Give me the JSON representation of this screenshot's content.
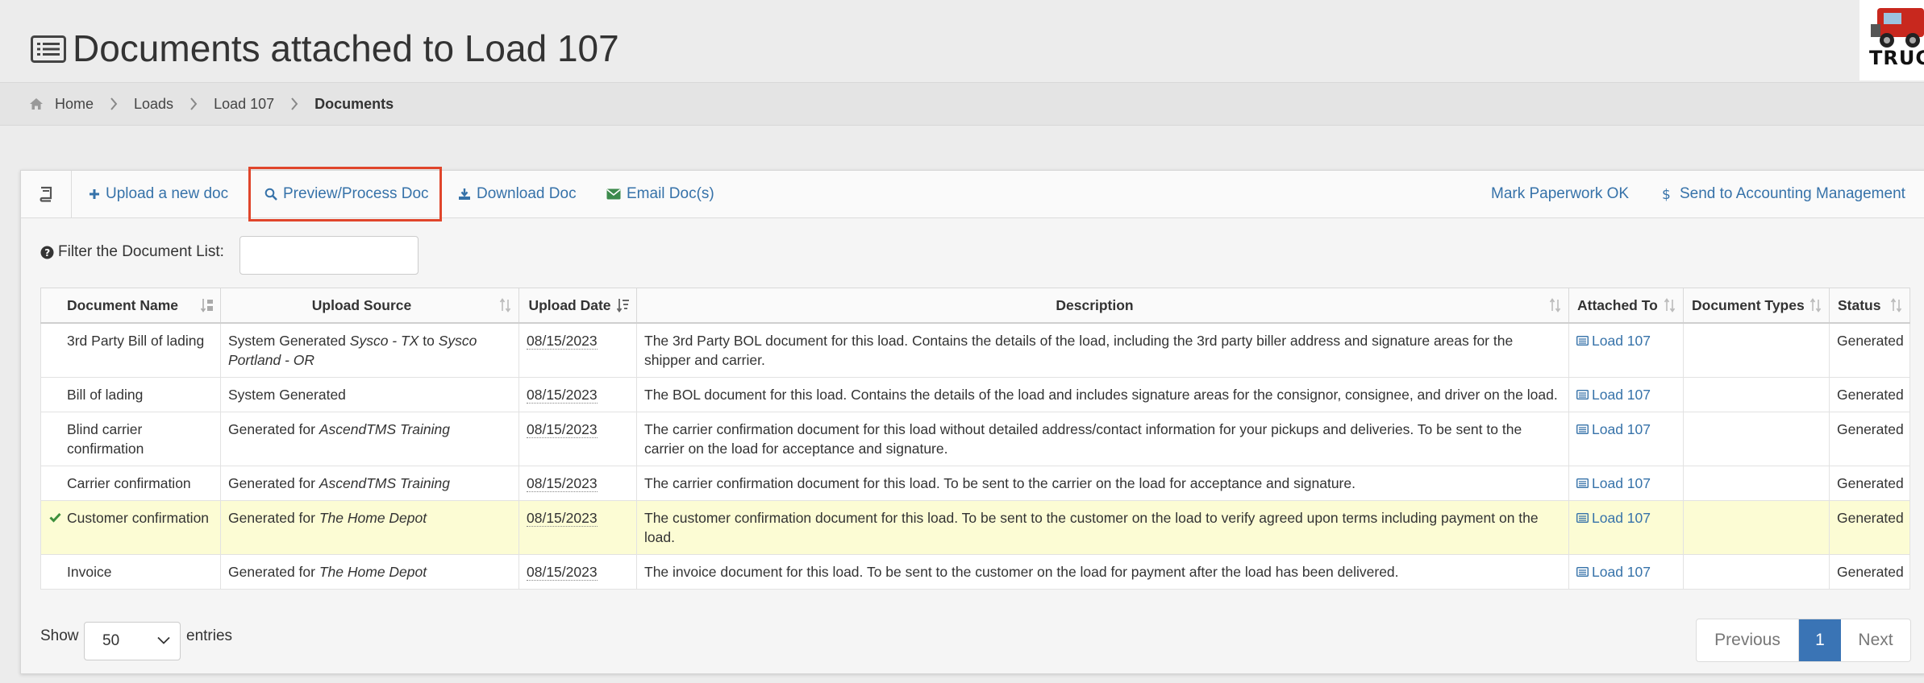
{
  "header": {
    "title": "Documents attached to Load 107",
    "logo_text": "TRUCK"
  },
  "breadcrumb": [
    {
      "label": "Home"
    },
    {
      "label": "Loads"
    },
    {
      "label": "Load 107"
    },
    {
      "label": "Documents"
    }
  ],
  "toolbar": {
    "upload": "Upload a new doc",
    "preview": "Preview/Process Doc",
    "download": "Download Doc",
    "email": "Email Doc(s)",
    "mark_ok": "Mark Paperwork OK",
    "send_accounting": "Send to Accounting Management"
  },
  "filter": {
    "label": "Filter the Document List:",
    "value": ""
  },
  "table": {
    "columns": [
      "Document Name",
      "Upload Source",
      "Upload Date",
      "Description",
      "Attached To",
      "Document Types",
      "Status"
    ],
    "rows": [
      {
        "name": "3rd Party Bill of lading",
        "source_prefix": "System Generated ",
        "source_em": "Sysco - TX",
        "source_mid": " to ",
        "source_em2": "Sysco Portland - OR",
        "date": "08/15/2023",
        "description": "The 3rd Party BOL document for this load. Contains the details of the load, including the 3rd party biller address and signature areas for the shipper and carrier.",
        "attached": "Load 107",
        "types": "",
        "status": "Generated"
      },
      {
        "name": "Bill of lading",
        "source_prefix": "System Generated",
        "source_em": "",
        "source_mid": "",
        "source_em2": "",
        "date": "08/15/2023",
        "description": "The BOL document for this load. Contains the details of the load and includes signature areas for the consignor, consignee, and driver on the load.",
        "attached": "Load 107",
        "types": "",
        "status": "Generated"
      },
      {
        "name": "Blind carrier confirmation",
        "source_prefix": "Generated for ",
        "source_em": "AscendTMS Training",
        "source_mid": "",
        "source_em2": "",
        "date": "08/15/2023",
        "description": "The carrier confirmation document for this load without detailed address/contact information for your pickups and deliveries. To be sent to the carrier on the load for acceptance and signature.",
        "attached": "Load 107",
        "types": "",
        "status": "Generated"
      },
      {
        "name": "Carrier confirmation",
        "source_prefix": "Generated for ",
        "source_em": "AscendTMS Training",
        "source_mid": "",
        "source_em2": "",
        "date": "08/15/2023",
        "description": "The carrier confirmation document for this load. To be sent to the carrier on the load for acceptance and signature.",
        "attached": "Load 107",
        "types": "",
        "status": "Generated"
      },
      {
        "name": "Customer confirmation",
        "source_prefix": "Generated for ",
        "source_em": "The Home Depot",
        "source_mid": "",
        "source_em2": "",
        "date": "08/15/2023",
        "description": "The customer confirmation document for this load. To be sent to the customer on the load to verify agreed upon terms including payment on the load.",
        "attached": "Load 107",
        "types": "",
        "status": "Generated"
      },
      {
        "name": "Invoice",
        "source_prefix": "Generated for ",
        "source_em": "The Home Depot",
        "source_mid": "",
        "source_em2": "",
        "date": "08/15/2023",
        "description": "The invoice document for this load. To be sent to the customer on the load for payment after the load has been delivered.",
        "attached": "Load 107",
        "types": "",
        "status": "Generated"
      }
    ]
  },
  "footer": {
    "show_label": "Show",
    "page_size": "50",
    "entries_label": "entries",
    "prev": "Previous",
    "current_page": "1",
    "next": "Next"
  }
}
